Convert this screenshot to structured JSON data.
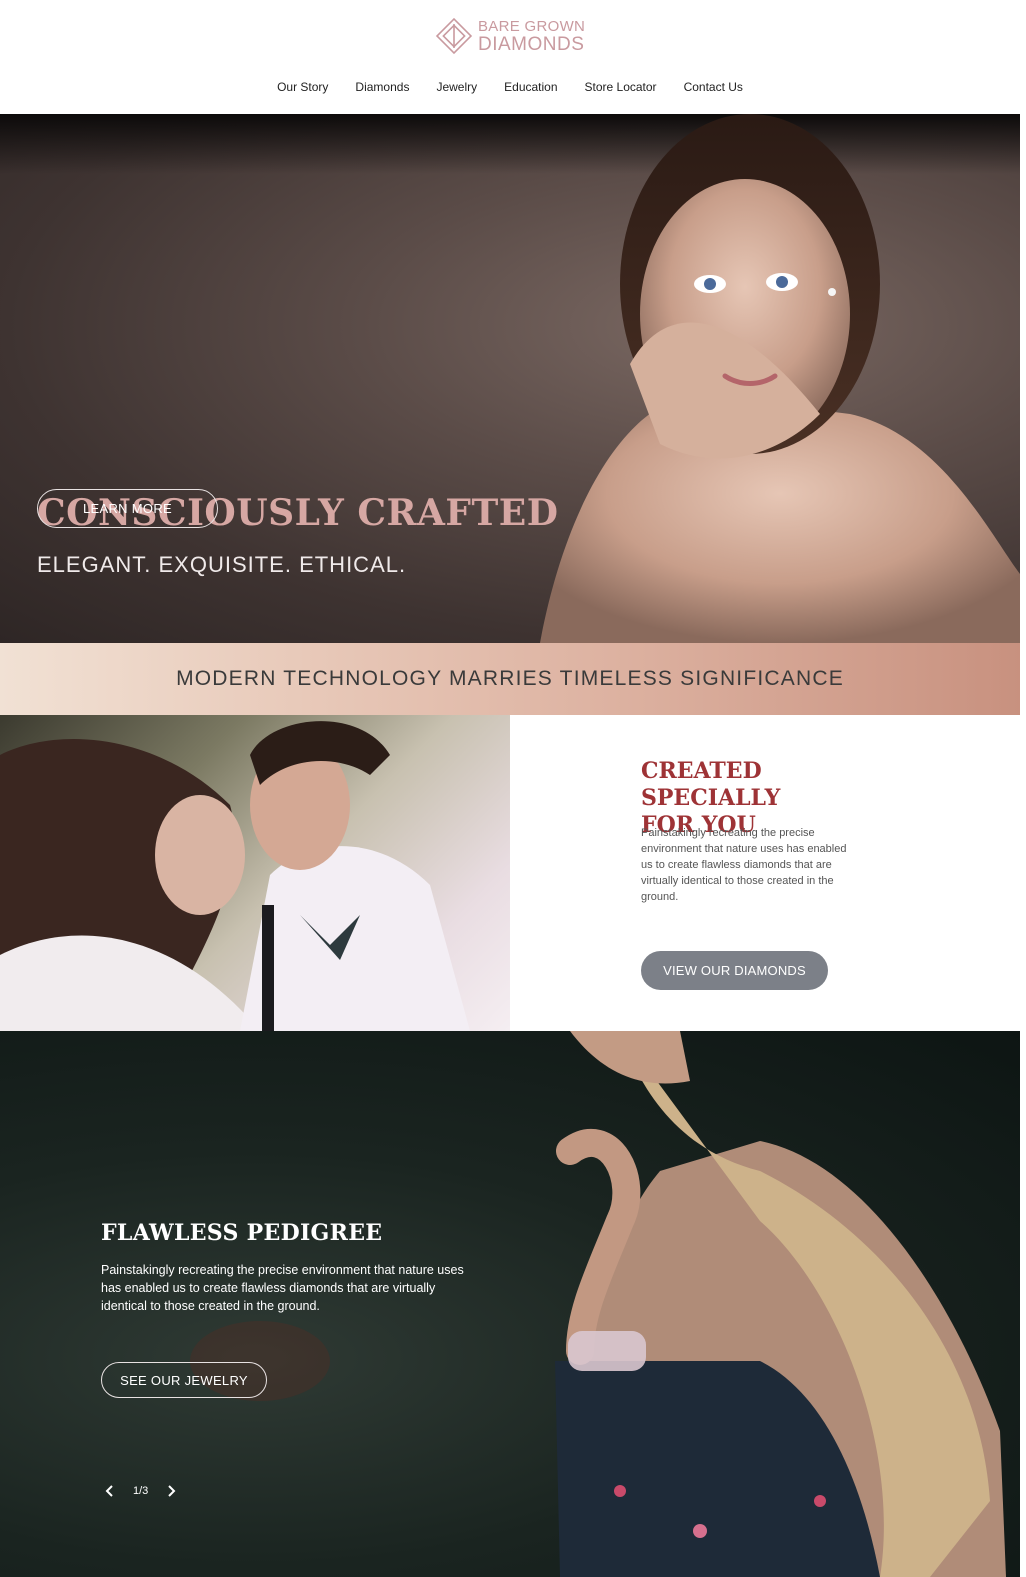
{
  "brand": {
    "line1": "BARE GROWN",
    "line2": "DIAMONDS",
    "color": "#c99a9f"
  },
  "nav": [
    {
      "label": "Our Story"
    },
    {
      "label": "Diamonds"
    },
    {
      "label": "Jewelry"
    },
    {
      "label": "Education"
    },
    {
      "label": "Store Locator"
    },
    {
      "label": "Contact Us"
    }
  ],
  "hero": {
    "title": "CONSCIOUSLY CRAFTED",
    "subtitle": "ELEGANT. EXQUISITE. ETHICAL.",
    "button": "LEARN MORE",
    "title_color": "#d6a7a3"
  },
  "banner": {
    "text": "MODERN TECHNOLOGY MARRIES TIMELESS SIGNIFICANCE"
  },
  "feature": {
    "title_line1": "CREATED SPECIALLY",
    "title_line2": "FOR YOU",
    "text": "Painstakingly recreating the precise environment that nature uses has enabled us to create flawless diamonds that are virtually identical to those created in the ground.",
    "button": "VIEW OUR DIAMONDS",
    "title_color": "#9e3336",
    "button_color": "#7c8088"
  },
  "pedigree": {
    "title": "FLAWLESS PEDIGREE",
    "text": "Painstakingly recreating the precise environment that nature uses has enabled us to create flawless diamonds that are virtually identical to those created in the ground.",
    "button": "SEE OUR JEWELRY",
    "slider": {
      "current": "1/3",
      "prev_icon": "chevron-left-icon",
      "next_icon": "chevron-right-icon"
    }
  }
}
